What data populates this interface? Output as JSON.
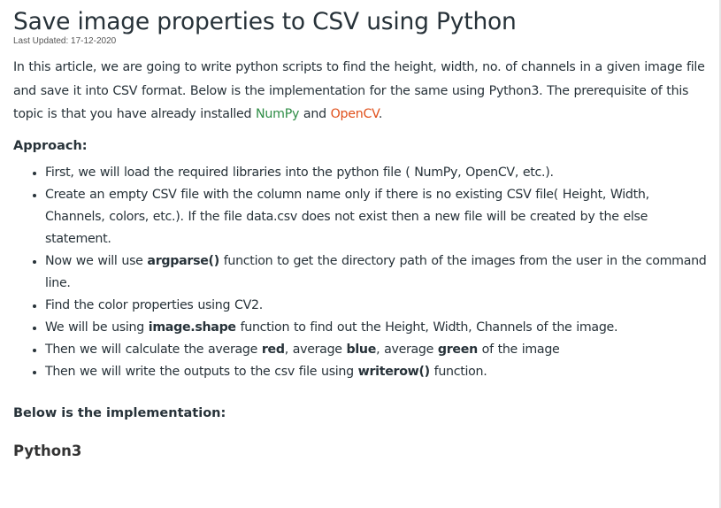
{
  "article": {
    "title": "Save image properties to CSV using Python",
    "last_updated": "Last Updated: 17-12-2020",
    "intro": {
      "text_before": "In this article, we are going to write python scripts to find the height, width, no. of channels in a given image file and save it into CSV format. Below is the implementation for the same using Python3. The prerequisite of this topic is that you have already installed ",
      "link_numpy": "NumPy",
      "text_and": " and ",
      "link_opencv": "OpenCV",
      "text_end": "."
    },
    "approach_heading": "Approach:",
    "steps": {
      "s1": "First, we will load the required libraries into the python file ( NumPy, OpenCV, etc.).",
      "s2": "Create an empty CSV file with the column name only if there is no existing CSV file( Height, Width, Channels, colors, etc.). If the file data.csv does not exist then a new file will be created by the else statement.",
      "s3_a": "Now we will use ",
      "s3_b": "argparse()",
      "s3_c": " function to get the directory path of the images from the user in the command line.",
      "s4": "Find the color properties using CV2.",
      "s5_a": "We will be using ",
      "s5_b": "image.shape",
      "s5_c": " function to find out the Height, Width, Channels of the image.",
      "s6_a": "Then we will calculate the average ",
      "s6_b": "red",
      "s6_c": ", average ",
      "s6_d": "blue",
      "s6_e": ", average ",
      "s6_f": "green",
      "s6_g": " of the image",
      "s7_a": "Then we will write the outputs to the csv file using ",
      "s7_b": "writerow()",
      "s7_c": " function."
    },
    "implementation_heading": "Below is the implementation:",
    "language_tab": "Python3"
  },
  "colors": {
    "text": "#273239",
    "numpy_link": "#2f8d46",
    "opencv_link": "#e04f1a"
  }
}
